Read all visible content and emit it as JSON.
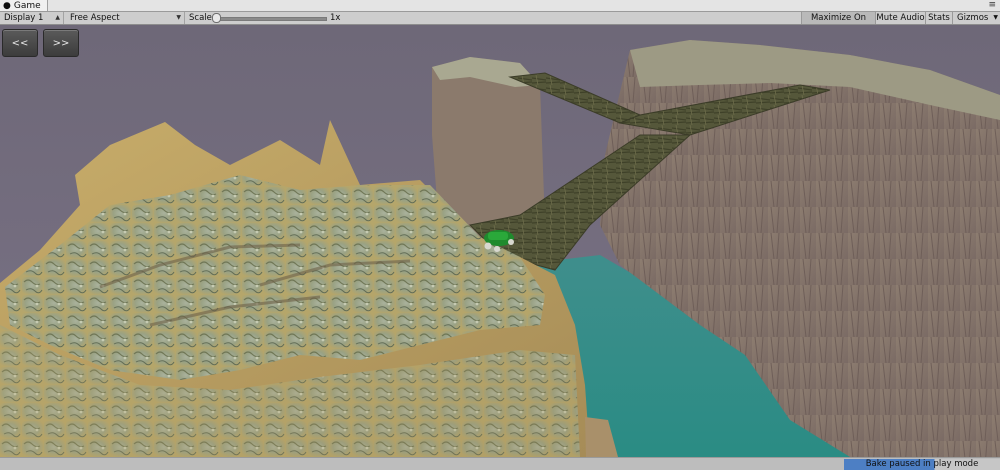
{
  "window": {
    "tab_title": "Game",
    "tab_icon": "game-controller-icon",
    "menu_icon": "window-menu-icon"
  },
  "toolbar": {
    "display": "Display 1",
    "aspect": "Free Aspect",
    "scale_label": "Scale",
    "scale_value": "1x",
    "scale_slider_fraction": 0.02,
    "maximize_on_play": "Maximize On Play",
    "mute_audio": "Mute Audio",
    "stats": "Stats",
    "gizmos": "Gizmos"
  },
  "overlay": {
    "prev_label": "<<",
    "next_label": ">>"
  },
  "status": {
    "bake_text": "Bake paused in play mode",
    "bake_progress": 0.58
  },
  "colors": {
    "sky": "#6f6979",
    "water": "#2f8d87",
    "cliff_left": "#b99f63",
    "cliff_right": "#8e7a6d",
    "bridge": "#5a5a3c",
    "vehicle": "#1e8a2a",
    "progress": "#4d7fc4"
  }
}
